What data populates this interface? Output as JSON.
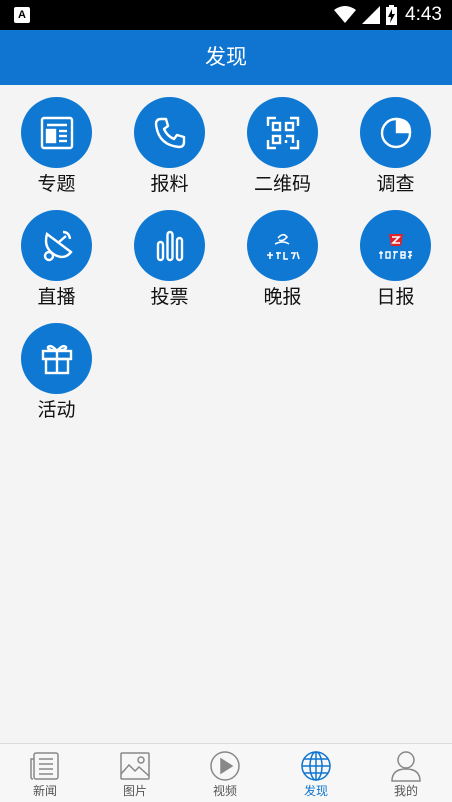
{
  "status_bar": {
    "notification_letter": "A",
    "time": "4:43"
  },
  "header": {
    "title": "发现"
  },
  "grid": {
    "items": [
      {
        "label": "专题",
        "icon": "newspaper-icon"
      },
      {
        "label": "报料",
        "icon": "phone-icon"
      },
      {
        "label": "二维码",
        "icon": "qr-code-icon"
      },
      {
        "label": "调查",
        "icon": "pie-chart-icon"
      },
      {
        "label": "直播",
        "icon": "satellite-dish-icon"
      },
      {
        "label": "投票",
        "icon": "bar-chart-icon"
      },
      {
        "label": "晚报",
        "icon": "evening-paper-logo-icon"
      },
      {
        "label": "日报",
        "icon": "daily-paper-logo-icon"
      },
      {
        "label": "活动",
        "icon": "gift-icon"
      }
    ]
  },
  "tab_bar": {
    "tabs": [
      {
        "label": "新闻",
        "icon": "news-icon"
      },
      {
        "label": "图片",
        "icon": "image-icon"
      },
      {
        "label": "视频",
        "icon": "play-icon"
      },
      {
        "label": "发现",
        "icon": "globe-icon"
      },
      {
        "label": "我的",
        "icon": "user-icon"
      }
    ],
    "active_tab": "发现"
  },
  "colors": {
    "accent": "#0f75d0",
    "circle": "#0e78d3",
    "background": "#f4f4f4"
  }
}
